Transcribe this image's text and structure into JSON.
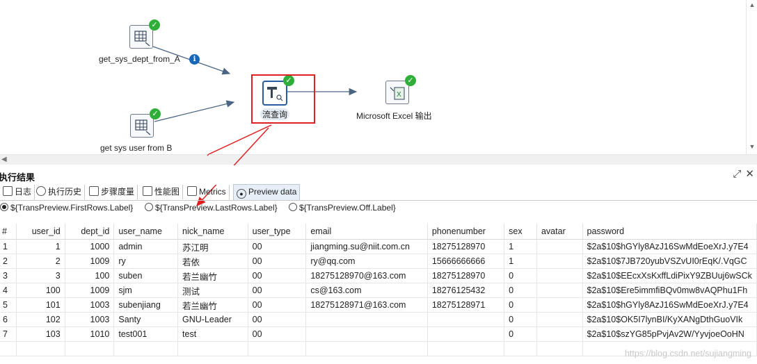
{
  "steps": {
    "dept": {
      "label": "get_sys_dept_from_A"
    },
    "user": {
      "label": "get sys user from B"
    },
    "lookup": {
      "label": "流查询"
    },
    "excel": {
      "label": "Microsoft Excel 输出"
    }
  },
  "icons": {
    "check": "✓",
    "info": "i"
  },
  "panel": {
    "title": "执行结果"
  },
  "tabs": [
    {
      "label": "日志",
      "icon": "log-icon"
    },
    {
      "label": "执行历史",
      "icon": "history-icon"
    },
    {
      "label": "步骤度量",
      "icon": "step-metrics-icon"
    },
    {
      "label": "性能图",
      "icon": "performance-icon"
    },
    {
      "label": "Metrics",
      "icon": "metrics-icon"
    },
    {
      "label": "Preview data",
      "icon": "eye-icon"
    }
  ],
  "radios": [
    {
      "label": "${TransPreview.FirstRows.Label}",
      "checked": true
    },
    {
      "label": "${TransPreview.LastRows.Label}",
      "checked": false
    },
    {
      "label": "${TransPreview.Off.Label}",
      "checked": false
    }
  ],
  "table": {
    "columns": [
      "#",
      "user_id",
      "dept_id",
      "user_name",
      "nick_name",
      "user_type",
      "email",
      "phonenumber",
      "sex",
      "avatar",
      "password"
    ],
    "rows": [
      [
        "1",
        "1",
        "1000",
        "admin",
        "苏江明",
        "00",
        "jiangming.su@niit.com.cn",
        "18275128970",
        "1",
        "",
        "$2a$10$hGYly8AzJ16SwMdEoeXrJ.y7E4"
      ],
      [
        "2",
        "2",
        "1009",
        "ry",
        "若依",
        "00",
        "ry@qq.com",
        "15666666666",
        "1",
        "",
        "$2a$10$7JB720yubVSZvUI0rEqK/.VqGC"
      ],
      [
        "3",
        "3",
        "100",
        "suben",
        "若兰幽竹",
        "00",
        "18275128970@163.com",
        "18275128970",
        "0",
        "",
        "$2a$10$EEcxXsKxffLdiPixY9ZBUuj6wSCk"
      ],
      [
        "4",
        "100",
        "1009",
        "sjm",
        "测试",
        "00",
        "cs@163.com",
        "18276125432",
        "0",
        "",
        "$2a$10$Ere5immfiBQv0mw8vAQPhu1Fh"
      ],
      [
        "5",
        "101",
        "1003",
        "subenjiang",
        "若兰幽竹",
        "00",
        "18275128971@163.com",
        "18275128971",
        "0",
        "",
        "$2a$10$hGYly8AzJ16SwMdEoeXrJ.y7E4"
      ],
      [
        "6",
        "102",
        "1003",
        "Santy",
        "GNU-Leader",
        "00",
        "",
        "",
        "0",
        "",
        "$2a$10$OK5I7lynBI/KyXANgDthGuoVIk"
      ],
      [
        "7",
        "103",
        "1010",
        "test001",
        "test",
        "00",
        "",
        "",
        "0",
        "",
        "$2a$10$szYG85pPvjAv2W/YyvjoeOoHN"
      ]
    ]
  },
  "watermark": "https://blog.csdn.net/sujiangming"
}
